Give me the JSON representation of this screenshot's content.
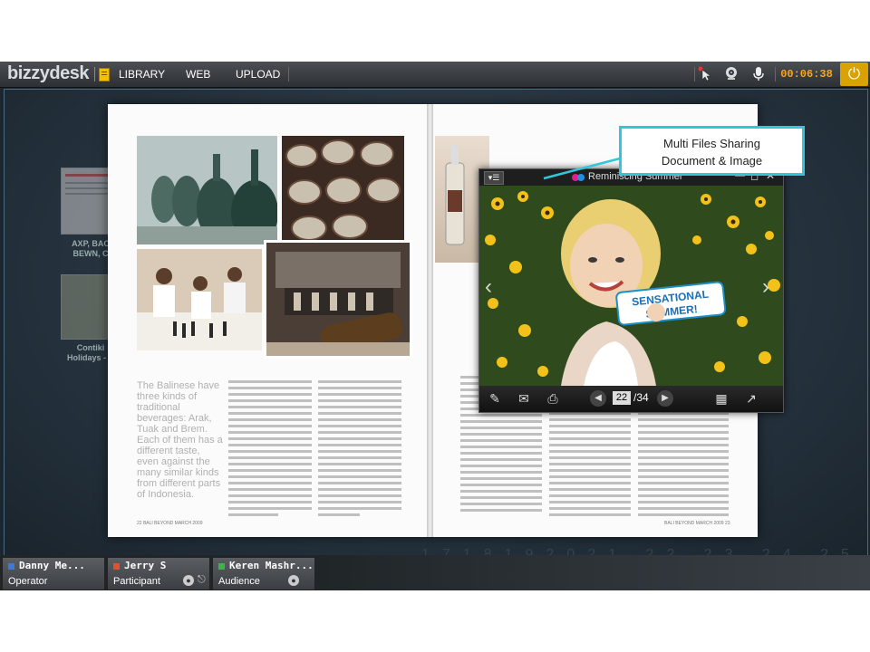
{
  "app": {
    "logo": "bizzydesk",
    "nav": [
      "LIBRARY",
      "WEB",
      "UPLOAD"
    ],
    "toolbar_icons": [
      "laser-pointer-icon",
      "webcam-icon",
      "microphone-icon"
    ],
    "timer": "00:06:38",
    "power_icon": "power-icon"
  },
  "library": {
    "items": [
      {
        "caption_line1": "AXP, BAC",
        "caption_line2": "BEWN, C"
      },
      {
        "caption_line1": "Contiki",
        "caption_line2": "Holidays - N"
      }
    ]
  },
  "document": {
    "left_pullquote": "The Balinese have three kinds of traditional beverages: Arak, Tuak and Brem. Each of them has a different taste, even against the many similar kinds from different parts of Indonesia.",
    "left_folio": "22   BALI BEYOND  MARCH 2009",
    "right_folio": "BALI BEYOND  MARCH 2009   23"
  },
  "viewer": {
    "title": "Reminiscing Summer",
    "image_caption_line1": "SENSATIONAL",
    "image_caption_line2": "SUMMER!",
    "current_page": "22",
    "total_pages": "/34",
    "accent": "#e0208a"
  },
  "callout": {
    "line1": "Multi Files Sharing",
    "line2": "Document & Image",
    "border_color": "#33c6d8"
  },
  "participants": [
    {
      "name": "Danny Me...",
      "role": "Operator",
      "color": "#3a7bd5"
    },
    {
      "name": "Jerry S",
      "role": "Participant",
      "color": "#e0522a"
    },
    {
      "name": "Keren Mashr...",
      "role": "Audience",
      "color": "#3cb44b"
    }
  ]
}
